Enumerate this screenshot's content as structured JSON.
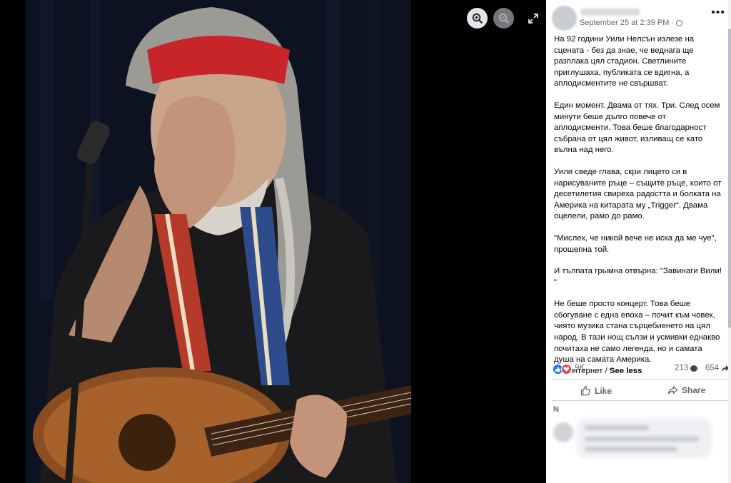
{
  "viewer": {
    "controls": {
      "zoom_in_icon": "magnifier-plus-icon",
      "zoom_out_icon": "magnifier-minus-icon",
      "expand_icon": "expand-arrows-icon"
    }
  },
  "post": {
    "timestamp": "September 25 at 2:39 PM",
    "separator": "·",
    "more_label": "•••",
    "paragraphs": [
      "На 92 години Уили Нелсън излезе на сцената - без да знае, че веднага ще разплака цял стадион. Светлините приглушаха, публиката се вдигна, а аплодисментите не свършват.",
      "Един момент. Двама от тях. Три. След осем минути беше дълго повече от аплодисменти. Това беше благодарност събрана от цял живот, изливащ се като вълна над него.",
      "Уили сведе глава, скри лицето си в нарисуваните ръце – същите ръце, които от десетилетия свиреха радостта и болката на Америка на китарата му „Trigger“. Двама оцелели, рамо до рамо.",
      "\"Мислех, че никой вече не иска да ме чуе\", прошепна той.",
      "И тълпата грымна отвърна: \"Завинаги Вили! \""
    ],
    "last_paragraph": "Не беше просто концерт. Това беше сбогуване с една епоха – почит към човек, чиято музика стана сърцебиенето на цял народ. В тази нощ сълзи и усмивки еднакво почитаха не само легенда, но и самата душа на самата Америка.",
    "source_line": "/От интернет /",
    "see_less": "See less"
  },
  "stats": {
    "reactions_count": "9K",
    "comments_count": "213",
    "shares_count": "654"
  },
  "actions": {
    "like_label": "Like",
    "share_label": "Share"
  },
  "comments": {
    "label": "N"
  },
  "colors": {
    "facebook_blue": "#1877f2",
    "love_red": "#f33e58",
    "secondary_text": "#65676b"
  }
}
